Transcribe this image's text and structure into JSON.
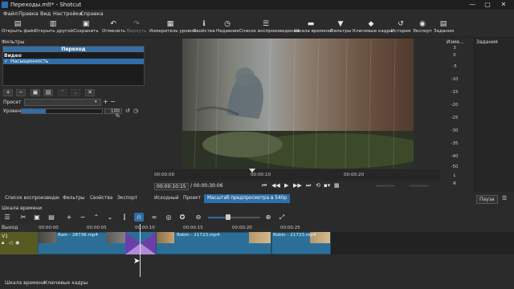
{
  "window": {
    "title": "Переходы.mlt* - Shotcut",
    "controls": [
      "—",
      "▢",
      "✕"
    ]
  },
  "menu": [
    "Файл",
    "Правка",
    "Вид",
    "Настройки",
    "Справка"
  ],
  "toolbar": [
    {
      "label": "Открыть файл",
      "icon": "folder-icon",
      "glyph": "▤"
    },
    {
      "label": "Открыть другой",
      "icon": "open-other-icon",
      "glyph": "▥"
    },
    {
      "label": "Сохранить",
      "icon": "save-icon",
      "glyph": "▣"
    },
    {
      "label": "Отменить",
      "icon": "undo-icon",
      "glyph": "↶"
    },
    {
      "label": "Вернуть",
      "icon": "redo-icon",
      "glyph": "↷"
    },
    {
      "label": "Измеритель уровня",
      "icon": "level-meter-icon",
      "glyph": "▦"
    },
    {
      "label": "Свойства",
      "icon": "properties-icon",
      "glyph": "ℹ"
    },
    {
      "label": "Недавние",
      "icon": "recent-icon",
      "glyph": "◷"
    },
    {
      "label": "Список воспроизведения",
      "icon": "playlist-icon",
      "glyph": "☰"
    },
    {
      "label": "Шкала времени",
      "icon": "timeline-icon",
      "glyph": "▬"
    },
    {
      "label": "Фильтры",
      "icon": "filter-icon",
      "glyph": "▼"
    },
    {
      "label": "Ключевые кадры",
      "icon": "keyframes-icon",
      "glyph": "◆"
    },
    {
      "label": "История",
      "icon": "history-icon",
      "glyph": "↺"
    },
    {
      "label": "Экспорт",
      "icon": "export-icon",
      "glyph": "◉"
    },
    {
      "label": "Задания",
      "icon": "jobs-icon",
      "glyph": "▤"
    }
  ],
  "filters": {
    "title": "Фильтры",
    "selected_header": "Переход",
    "category": "Видео",
    "item": "Насыщенность",
    "check": "✓",
    "preset_label": "Пресет",
    "preset_value": "",
    "level_label": "Уровень",
    "level_value": "100 %",
    "level_fraction": 0.3
  },
  "player": {
    "timecode_current": "00:00:10:15",
    "timecode_total": "/ 00:00:30:06",
    "inout_left": "--:--:--:--",
    "inout_right": "--:--:--:--",
    "scrub_labels": [
      "00:00:00",
      "00:00:10",
      "00:00:20"
    ]
  },
  "audio": {
    "title": "Изме...",
    "scale": [
      "3",
      "0",
      "-5",
      "-10",
      "-15",
      "-20",
      "-25",
      "-30",
      "-35",
      "-40",
      "-50"
    ],
    "channels": [
      "L",
      "R"
    ]
  },
  "jobs": {
    "title": "Задания",
    "pause_label": "Пауза"
  },
  "tabs_left": [
    "Список воспроизведения",
    "Фильтры",
    "Свойства",
    "Экспорт"
  ],
  "tabs_player": [
    "Исходный",
    "Проект",
    "Масштаб предпросмотра в 540p"
  ],
  "timeline": {
    "title": "Шкала времени",
    "output_label": "Выход",
    "track_label": "V1",
    "ruler": [
      "00:00:00",
      "00:00:05",
      "00:00:10",
      "00:00:15",
      "00:00:20",
      "00:00:25"
    ],
    "clips": [
      "Rain - 28736.mp4",
      "Robin - 21723.mp4",
      "Robin - 21723.mp4"
    ]
  },
  "bottom_tabs": [
    "Шкала времени",
    "Ключевые кадры"
  ]
}
